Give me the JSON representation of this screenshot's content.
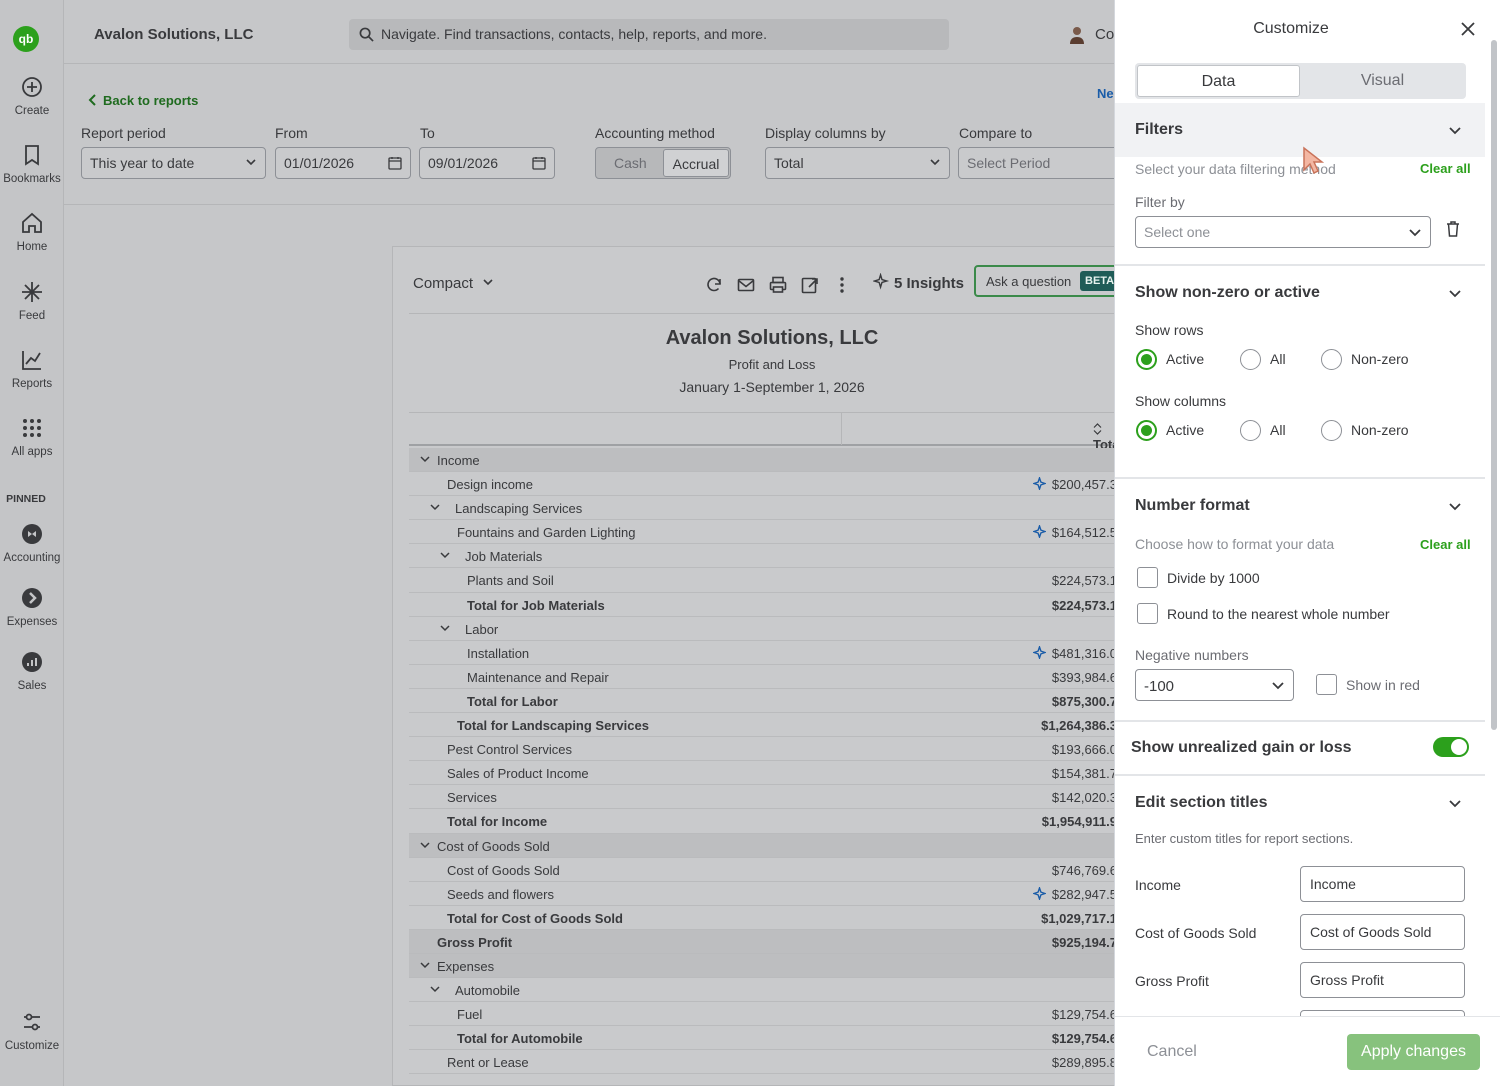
{
  "app": {
    "company_name": "Avalon Solutions, LLC",
    "search_placeholder": "Navigate. Find transactions, contacts, help, reports, and more.",
    "user_initial": "Co"
  },
  "leftnav": {
    "items": [
      {
        "label": "Create",
        "icon": "plus-circle-icon"
      },
      {
        "label": "Bookmarks",
        "icon": "bookmark-icon"
      },
      {
        "label": "Home",
        "icon": "home-icon"
      },
      {
        "label": "Feed",
        "icon": "sparkle-icon"
      },
      {
        "label": "Reports",
        "icon": "line-chart-icon"
      },
      {
        "label": "All apps",
        "icon": "grid-icon"
      }
    ],
    "pinned_label": "PINNED",
    "pinned": [
      {
        "label": "Accounting",
        "icon": "accounting-icon"
      },
      {
        "label": "Expenses",
        "icon": "expenses-icon"
      },
      {
        "label": "Sales",
        "icon": "sales-icon"
      }
    ],
    "customize_label": "Customize"
  },
  "controls": {
    "back_label": "Back to reports",
    "new_link": "Ne",
    "report_period_label": "Report period",
    "report_period_value": "This year to date",
    "from_label": "From",
    "from_value": "01/01/2026",
    "to_label": "To",
    "to_value": "09/01/2026",
    "accounting_method_label": "Accounting method",
    "cash": "Cash",
    "accrual": "Accrual",
    "display_columns_label": "Display columns by",
    "display_columns_value": "Total",
    "compare_label": "Compare to",
    "compare_value": "Select Period"
  },
  "report": {
    "view": "Compact",
    "insights": "5 Insights",
    "ask": "Ask a question",
    "beta": "BETA",
    "title": "Avalon Solutions, LLC",
    "subtitle": "Profit and Loss",
    "date_range": "January 1-September 1, 2026",
    "column_header": "Tota",
    "rows": [
      {
        "name": "Income",
        "amount": "",
        "indent": 0,
        "caret": true,
        "section": true,
        "bold": false,
        "spark": false
      },
      {
        "name": "Design income",
        "amount": "$200,457.3",
        "indent": 1,
        "caret": false,
        "section": false,
        "bold": false,
        "spark": true
      },
      {
        "name": "Landscaping Services",
        "amount": "",
        "indent": 1,
        "caret": true,
        "section": false,
        "bold": false,
        "spark": false
      },
      {
        "name": "Fountains and Garden Lighting",
        "amount": "$164,512.5",
        "indent": 2,
        "caret": false,
        "section": false,
        "bold": false,
        "spark": true
      },
      {
        "name": "Job Materials",
        "amount": "",
        "indent": 2,
        "caret": true,
        "section": false,
        "bold": false,
        "spark": false
      },
      {
        "name": "Plants and Soil",
        "amount": "$224,573.1",
        "indent": 3,
        "caret": false,
        "section": false,
        "bold": false,
        "spark": false
      },
      {
        "name": "Total for Job Materials",
        "amount": "$224,573.1",
        "indent": 3,
        "caret": false,
        "section": false,
        "bold": true,
        "spark": false
      },
      {
        "name": "Labor",
        "amount": "",
        "indent": 2,
        "caret": true,
        "section": false,
        "bold": false,
        "spark": false
      },
      {
        "name": "Installation",
        "amount": "$481,316.0",
        "indent": 3,
        "caret": false,
        "section": false,
        "bold": false,
        "spark": true
      },
      {
        "name": "Maintenance and Repair",
        "amount": "$393,984.6",
        "indent": 3,
        "caret": false,
        "section": false,
        "bold": false,
        "spark": false
      },
      {
        "name": "Total for Labor",
        "amount": "$875,300.7",
        "indent": 3,
        "caret": false,
        "section": false,
        "bold": true,
        "spark": false
      },
      {
        "name": "Total for Landscaping Services",
        "amount": "$1,264,386.3",
        "indent": 2,
        "caret": false,
        "section": false,
        "bold": true,
        "spark": false
      },
      {
        "name": "Pest Control Services",
        "amount": "$193,666.0",
        "indent": 1,
        "caret": false,
        "section": false,
        "bold": false,
        "spark": false
      },
      {
        "name": "Sales of Product Income",
        "amount": "$154,381.7",
        "indent": 1,
        "caret": false,
        "section": false,
        "bold": false,
        "spark": false
      },
      {
        "name": "Services",
        "amount": "$142,020.3",
        "indent": 1,
        "caret": false,
        "section": false,
        "bold": false,
        "spark": false
      },
      {
        "name": "Total for Income",
        "amount": "$1,954,911.9",
        "indent": 1,
        "caret": false,
        "section": false,
        "bold": true,
        "spark": false
      },
      {
        "name": "Cost of Goods Sold",
        "amount": "",
        "indent": 0,
        "caret": true,
        "section": true,
        "bold": false,
        "spark": false
      },
      {
        "name": "Cost of Goods Sold",
        "amount": "$746,769.6",
        "indent": 1,
        "caret": false,
        "section": false,
        "bold": false,
        "spark": false
      },
      {
        "name": "Seeds and flowers",
        "amount": "$282,947.5",
        "indent": 1,
        "caret": false,
        "section": false,
        "bold": false,
        "spark": true
      },
      {
        "name": "Total for Cost of Goods Sold",
        "amount": "$1,029,717.1",
        "indent": 1,
        "caret": false,
        "section": false,
        "bold": true,
        "spark": false
      },
      {
        "name": "Gross Profit",
        "amount": "$925,194.7",
        "indent": 0,
        "caret": false,
        "section": true,
        "bold": true,
        "spark": false
      },
      {
        "name": "Expenses",
        "amount": "",
        "indent": 0,
        "caret": true,
        "section": true,
        "bold": false,
        "spark": false
      },
      {
        "name": "Automobile",
        "amount": "",
        "indent": 1,
        "caret": true,
        "section": false,
        "bold": false,
        "spark": false
      },
      {
        "name": "Fuel",
        "amount": "$129,754.6",
        "indent": 2,
        "caret": false,
        "section": false,
        "bold": false,
        "spark": false
      },
      {
        "name": "Total for Automobile",
        "amount": "$129,754.6",
        "indent": 2,
        "caret": false,
        "section": false,
        "bold": true,
        "spark": false
      },
      {
        "name": "Rent or Lease",
        "amount": "$289,895.8",
        "indent": 1,
        "caret": false,
        "section": false,
        "bold": false,
        "spark": false
      }
    ]
  },
  "panel": {
    "title": "Customize",
    "tab_data": "Data",
    "tab_visual": "Visual",
    "filters": {
      "heading": "Filters",
      "description": "Select your data filtering method",
      "clear_all": "Clear all",
      "filter_by_label": "Filter by",
      "filter_by_placeholder": "Select one"
    },
    "nonzero": {
      "heading": "Show non-zero or active",
      "rows_label": "Show rows",
      "columns_label": "Show columns",
      "options": [
        "Active",
        "All",
        "Non-zero"
      ],
      "rows_selected": "Active",
      "columns_selected": "Active"
    },
    "number_format": {
      "heading": "Number format",
      "description": "Choose how to format your data",
      "clear_all": "Clear all",
      "divide": "Divide by 1000",
      "round": "Round to the nearest whole number",
      "negative_label": "Negative numbers",
      "negative_value": "-100",
      "show_red": "Show in red"
    },
    "unrealized": {
      "label": "Show unrealized gain or loss",
      "enabled": true
    },
    "section_titles": {
      "heading": "Edit section titles",
      "description": "Enter custom titles for report sections.",
      "items": [
        {
          "label": "Income",
          "value": "Income"
        },
        {
          "label": "Cost of Goods Sold",
          "value": "Cost of Goods Sold"
        },
        {
          "label": "Gross Profit",
          "value": "Gross Profit"
        }
      ]
    },
    "cancel": "Cancel",
    "apply": "Apply changes"
  },
  "colors": {
    "brand_green": "#2ca01c",
    "link_blue": "#1a5ca8",
    "apply_disabled": "#87c27d"
  }
}
